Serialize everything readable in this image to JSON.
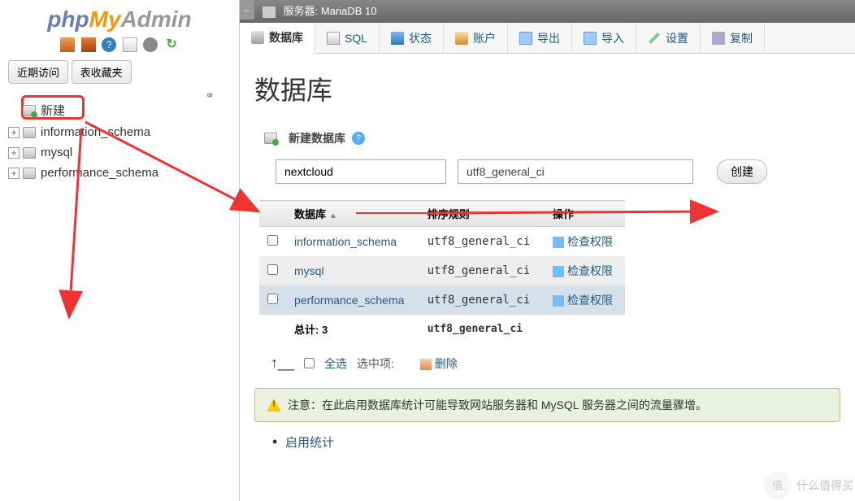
{
  "logo": {
    "p1": "php",
    "p2": "My",
    "p3": "Admin"
  },
  "sidebar": {
    "recent": "近期访问",
    "favorites": "表收藏夹",
    "new": "新建",
    "dbs": [
      "information_schema",
      "mysql",
      "performance_schema"
    ]
  },
  "breadcrumb": {
    "label": "服务器: MariaDB 10"
  },
  "tabs": {
    "database": "数据库",
    "sql": "SQL",
    "status": "状态",
    "accounts": "账户",
    "export": "导出",
    "import": "导入",
    "settings": "设置",
    "replication": "复制"
  },
  "page": {
    "heading": "数据库",
    "create_label": "新建数据库",
    "db_name_value": "nextcloud",
    "collation_value": "utf8_general_ci",
    "create_btn": "创建"
  },
  "table": {
    "col_db": "数据库",
    "col_collation": "排序规则",
    "col_action": "操作",
    "rows": [
      {
        "name": "information_schema",
        "collation": "utf8_general_ci",
        "action": "检查权限"
      },
      {
        "name": "mysql",
        "collation": "utf8_general_ci",
        "action": "检查权限"
      },
      {
        "name": "performance_schema",
        "collation": "utf8_general_ci",
        "action": "检查权限"
      }
    ],
    "total_label": "总计: 3",
    "total_collation": "utf8_general_ci"
  },
  "bulk": {
    "select_all": "全选",
    "with_selected": "选中项:",
    "delete": "删除"
  },
  "notice": "注意：在此启用数据库统计可能导致网站服务器和 MySQL 服务器之间的流量骤增。",
  "enable_stats": "启用统计",
  "watermark": "什么值得买"
}
